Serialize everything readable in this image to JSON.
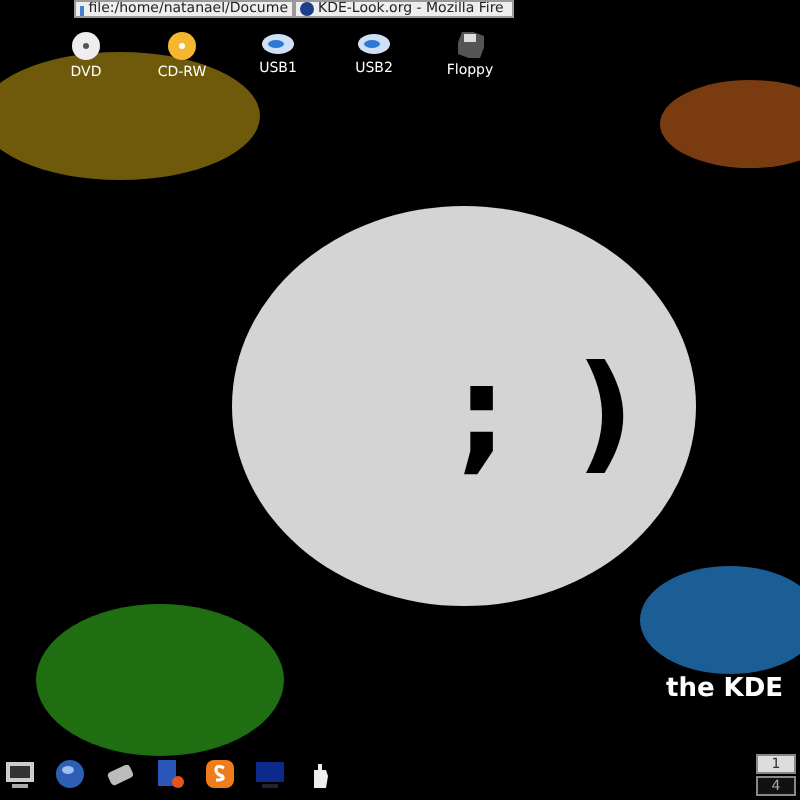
{
  "taskbar": {
    "tasks": [
      {
        "label": "file:/home/natanael/Docume",
        "kind": "folder"
      },
      {
        "label": "KDE-Look.org - Mozilla Fire",
        "kind": "browser"
      }
    ]
  },
  "desktop_icons": [
    {
      "label": "DVD",
      "kind": "dvd"
    },
    {
      "label": "CD-RW",
      "kind": "cdrw"
    },
    {
      "label": "USB1",
      "kind": "usb"
    },
    {
      "label": "USB2",
      "kind": "usb"
    },
    {
      "label": "Floppy",
      "kind": "floppy"
    }
  ],
  "wallpaper": {
    "smiley": "; )",
    "slogan": "the KDE"
  },
  "launcher": [
    {
      "kind": "monitor"
    },
    {
      "kind": "globe"
    },
    {
      "kind": "drive"
    },
    {
      "kind": "book"
    },
    {
      "kind": "s-logo"
    },
    {
      "kind": "screen"
    },
    {
      "kind": "hand"
    }
  ],
  "pager": [
    {
      "label": "1",
      "selected": true
    },
    {
      "label": "4",
      "selected": false
    }
  ]
}
